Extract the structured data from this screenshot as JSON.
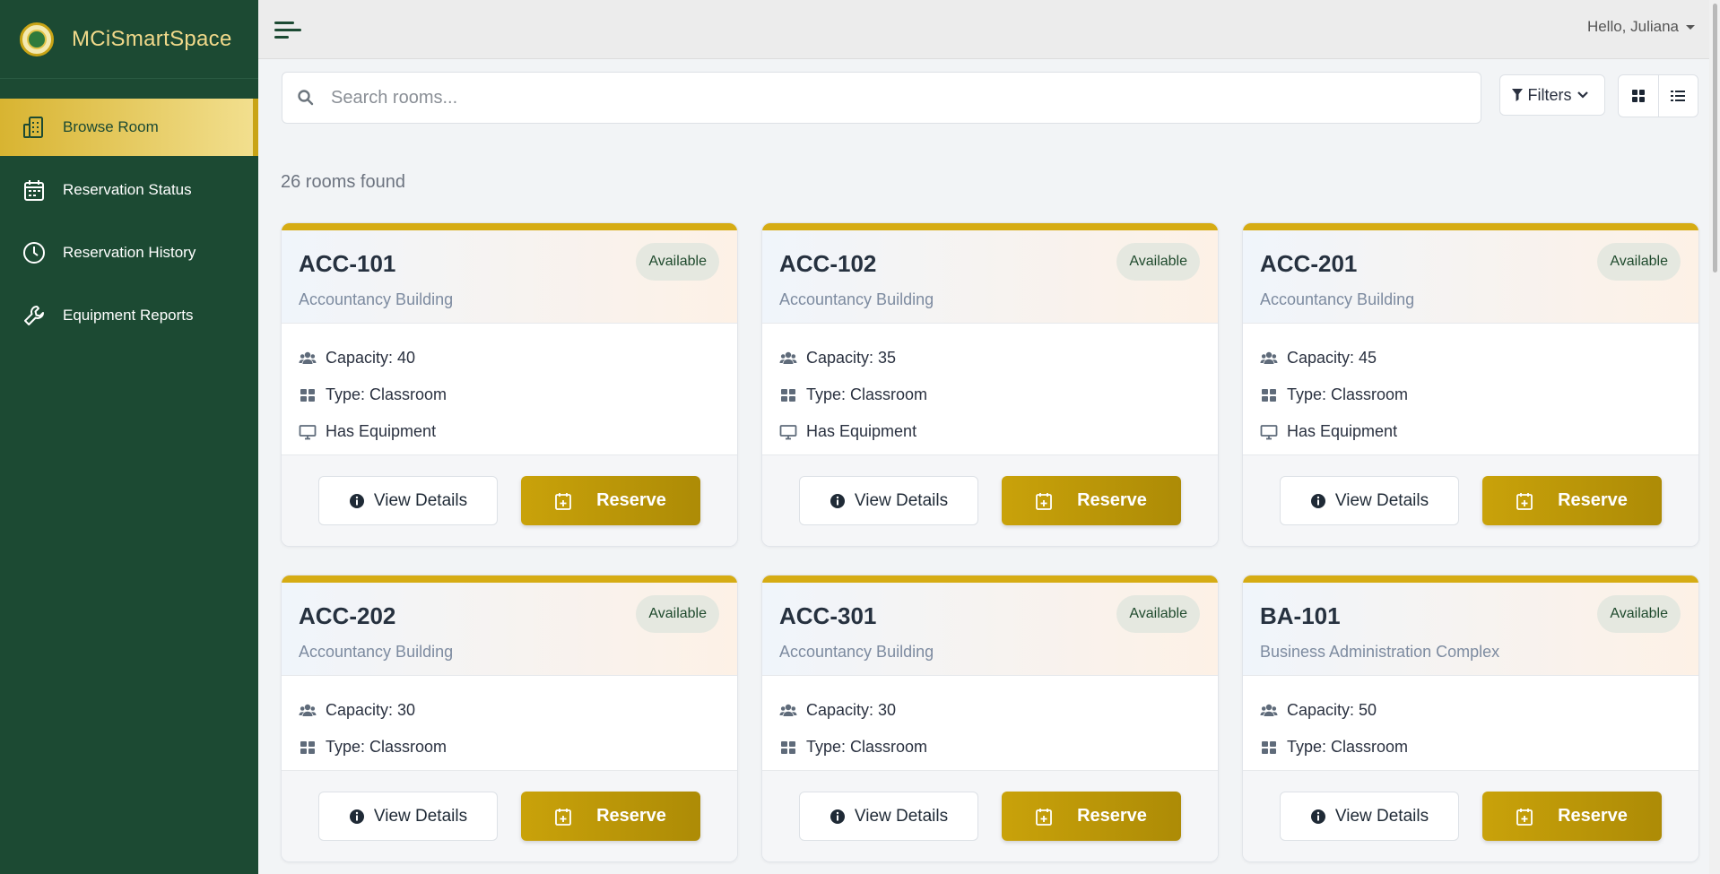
{
  "app": {
    "brand": "MCiSmartSpace",
    "greeting": "Hello, Juliana"
  },
  "sidebar": {
    "items": [
      {
        "label": "Browse Room",
        "icon": "building-icon",
        "active": true
      },
      {
        "label": "Reservation Status",
        "icon": "calendar-icon",
        "active": false
      },
      {
        "label": "Reservation History",
        "icon": "clock-icon",
        "active": false
      },
      {
        "label": "Equipment Reports",
        "icon": "wrench-icon",
        "active": false
      }
    ]
  },
  "toolbar": {
    "search_placeholder": "Search rooms...",
    "filters_label": "Filters",
    "views": [
      "grid-view-icon",
      "list-view-icon"
    ]
  },
  "results": {
    "count_text": "26 rooms found"
  },
  "cards": [
    {
      "name": "ACC-101",
      "building": "Accountancy Building",
      "status": "Available",
      "capacity": "Capacity: 40",
      "type": "Type: Classroom",
      "equipment": "Has Equipment",
      "details_label": "View Details",
      "reserve_label": "Reserve"
    },
    {
      "name": "ACC-102",
      "building": "Accountancy Building",
      "status": "Available",
      "capacity": "Capacity: 35",
      "type": "Type: Classroom",
      "equipment": "Has Equipment",
      "details_label": "View Details",
      "reserve_label": "Reserve"
    },
    {
      "name": "ACC-201",
      "building": "Accountancy Building",
      "status": "Available",
      "capacity": "Capacity: 45",
      "type": "Type: Classroom",
      "equipment": "Has Equipment",
      "details_label": "View Details",
      "reserve_label": "Reserve"
    },
    {
      "name": "ACC-202",
      "building": "Accountancy Building",
      "status": "Available",
      "capacity": "Capacity: 30",
      "type": "Type: Classroom",
      "details_label": "View Details",
      "reserve_label": "Reserve"
    },
    {
      "name": "ACC-301",
      "building": "Accountancy Building",
      "status": "Available",
      "capacity": "Capacity: 30",
      "type": "Type: Classroom",
      "details_label": "View Details",
      "reserve_label": "Reserve"
    },
    {
      "name": "BA-101",
      "building": "Business Administration Complex",
      "status": "Available",
      "capacity": "Capacity: 50",
      "type": "Type: Classroom",
      "details_label": "View Details",
      "reserve_label": "Reserve"
    }
  ],
  "colors": {
    "sidebar": "#1c4a33",
    "accent": "#c9a20a",
    "brand_text": "#f1d98a"
  }
}
